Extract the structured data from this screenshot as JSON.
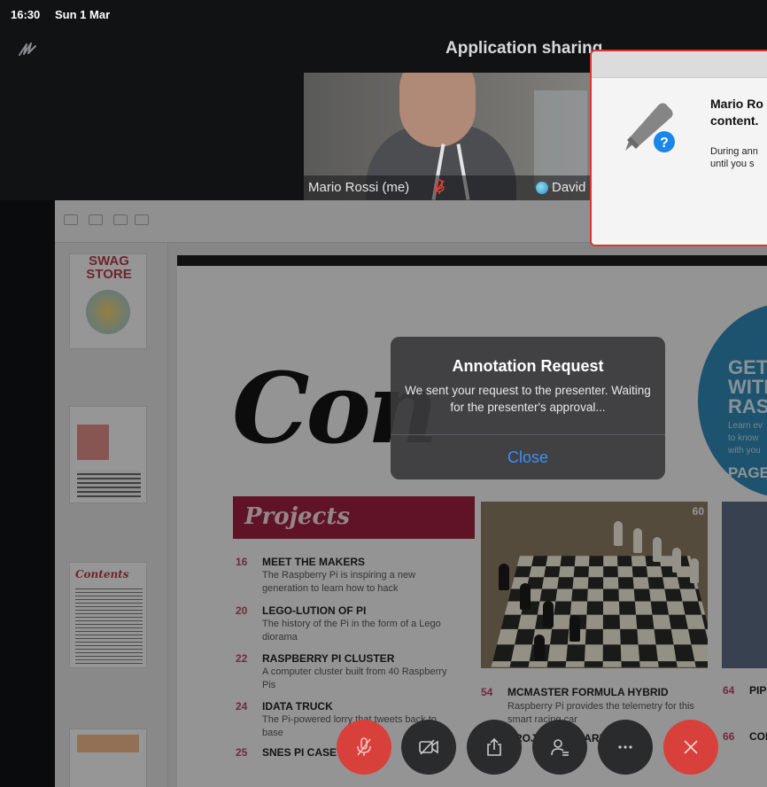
{
  "status_bar": {
    "time": "16:30",
    "date": "Sun 1 Mar"
  },
  "header": {
    "title": "Application sharing"
  },
  "video": {
    "self_name": "Mario Rossi (me)",
    "other_name": "David"
  },
  "shared_doc": {
    "magazine_word": "Con",
    "cta_lines": [
      "GET",
      "WITH",
      "RAS"
    ],
    "cta_small": [
      "Learn ev",
      "to know",
      "with you"
    ],
    "cta_page": "PAGE",
    "sidebar_top_text": [
      "SWAG",
      "STORE"
    ],
    "thumb_contents": "Contents",
    "section_label": "Projects",
    "toc": [
      {
        "num": "16",
        "title": "MEET THE MAKERS",
        "desc": "The Raspberry Pi is inspiring a new generation to learn how to hack"
      },
      {
        "num": "20",
        "title": "LEGO-LUTION OF PI",
        "desc": "The history of the Pi in the form of a Lego diorama"
      },
      {
        "num": "22",
        "title": "RASPBERRY PI CLUSTER",
        "desc": "A computer cluster built from 40 Raspberry Pis"
      },
      {
        "num": "24",
        "title": "IDATA TRUCK",
        "desc": "The Pi-powered lorry that tweets back to base"
      },
      {
        "num": "25",
        "title": "SNES PI CASE",
        "desc": ""
      }
    ],
    "photo_badge": "60",
    "item54": {
      "num": "54",
      "title": "MCMASTER FORMULA HYBRID",
      "desc": "Raspberry Pi provides the telemetry for this smart racing car"
    },
    "item_pi": {
      "num": "64",
      "title": "PIP"
    },
    "item_co": {
      "num": "66",
      "title": "COI"
    },
    "item_quarium_title": "PROJECT AQUARIUM"
  },
  "annotation_dialog": {
    "title": "Annotation Request",
    "message": "We sent your request to the presenter. Waiting for the presenter's approval...",
    "close_label": "Close"
  },
  "mac_dialog": {
    "heading_line1": "Mario Ro",
    "heading_line2": "content.",
    "text_line1": "During ann",
    "text_line2": "until you s"
  },
  "controls": [
    {
      "name": "mute-mic",
      "style": "red"
    },
    {
      "name": "video-off",
      "style": "dark"
    },
    {
      "name": "share",
      "style": "dark"
    },
    {
      "name": "participants",
      "style": "dark"
    },
    {
      "name": "more",
      "style": "dark"
    },
    {
      "name": "end-call",
      "style": "red"
    }
  ]
}
